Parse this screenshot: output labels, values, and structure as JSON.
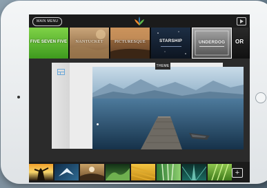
{
  "top_bar": {
    "main_menu_label": "MAIN MENU",
    "logo_icon": "haiku-deck-logo-icon",
    "play_icon": "play-icon"
  },
  "themes": [
    {
      "label": "FIVE SEVEN FIVE"
    },
    {
      "label": "NANTUCKET"
    },
    {
      "label": "PICTURESQUE"
    },
    {
      "label": "STARSHIP"
    },
    {
      "label": "UNDERDOG"
    },
    {
      "label": "OR"
    }
  ],
  "canvas": {
    "theme_badge": "THEME",
    "layout_icon": "layout-icon"
  },
  "colors": {
    "accent": "#6aa7d8",
    "dark_ui": "#1b1b1b"
  },
  "bottom_bar": {
    "add_label": "+"
  }
}
